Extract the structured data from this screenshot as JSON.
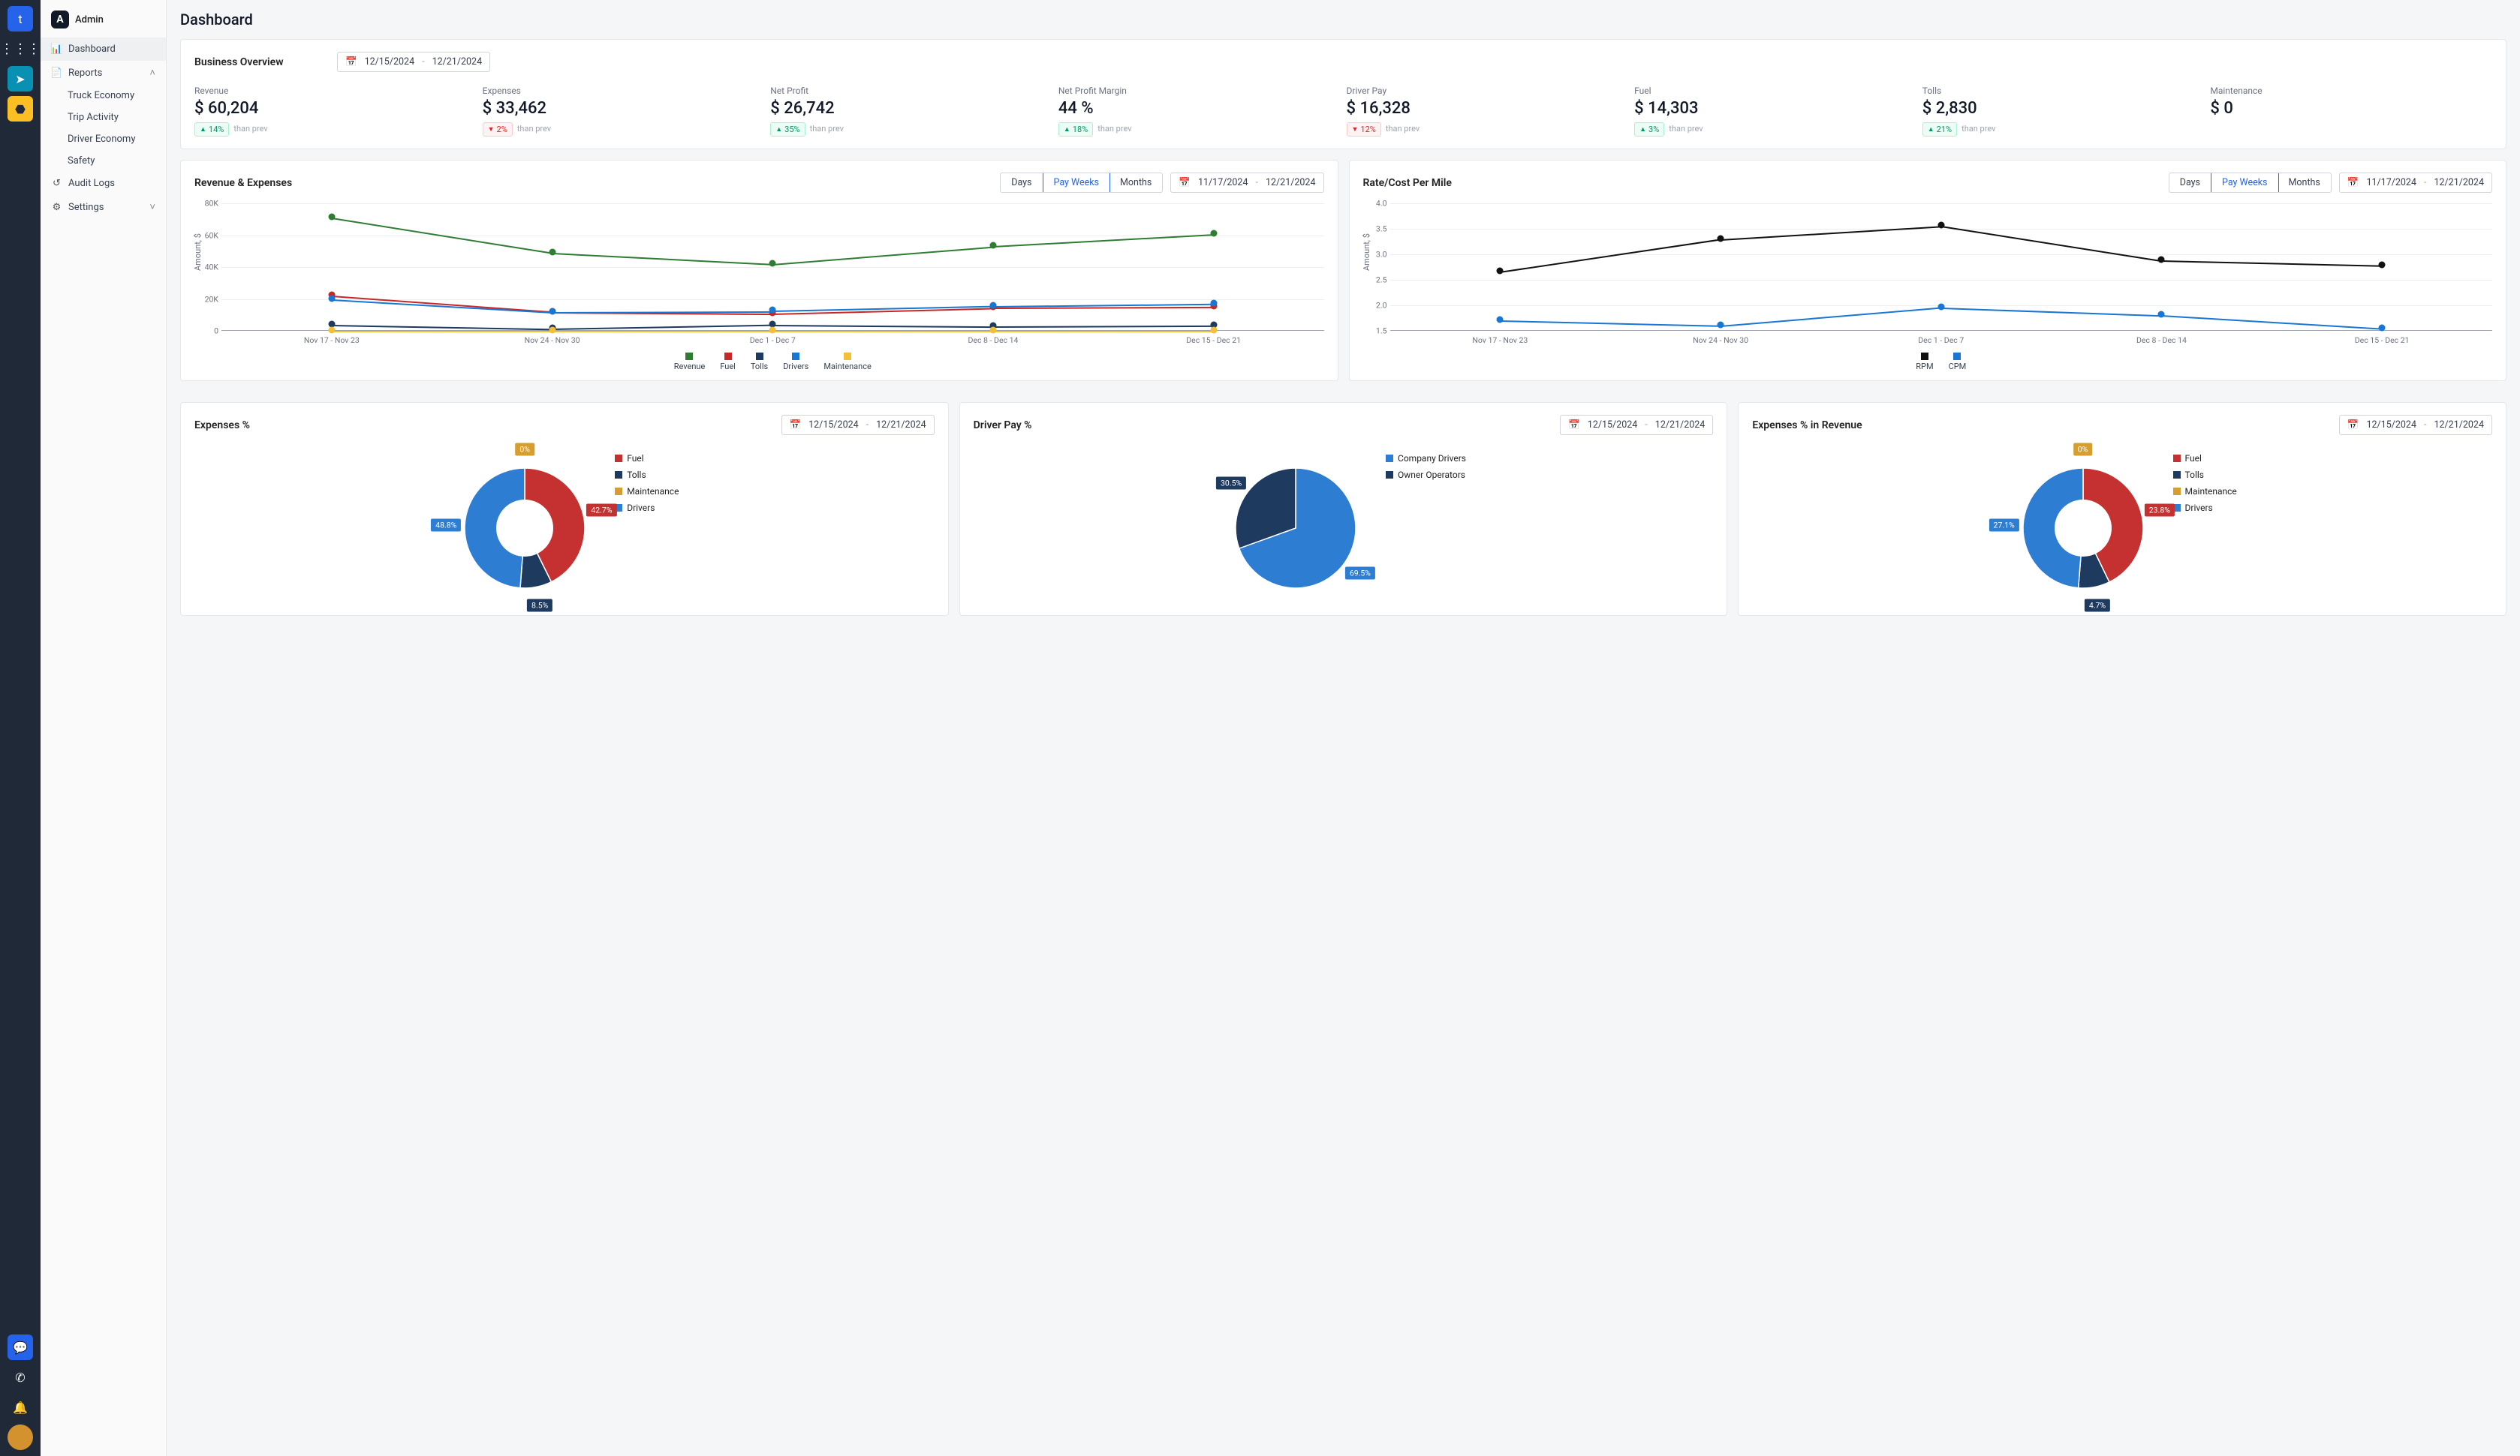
{
  "brand": {
    "user": "Admin",
    "logo_letter": "A"
  },
  "nav": {
    "dashboard": "Dashboard",
    "reports": "Reports",
    "reports_children": [
      "Truck Economy",
      "Trip Activity",
      "Driver Economy",
      "Safety"
    ],
    "audit_logs": "Audit Logs",
    "settings": "Settings"
  },
  "page_title": "Dashboard",
  "overview": {
    "title": "Business Overview",
    "date_from": "12/15/2024",
    "date_to": "12/21/2024",
    "prev_text": "than prev",
    "metrics": [
      {
        "label": "Revenue",
        "value": "$ 60,204",
        "delta": "14%",
        "dir": "up"
      },
      {
        "label": "Expenses",
        "value": "$ 33,462",
        "delta": "2%",
        "dir": "down"
      },
      {
        "label": "Net Profit",
        "value": "$ 26,742",
        "delta": "35%",
        "dir": "up"
      },
      {
        "label": "Net Profit Margin",
        "value": "44 %",
        "delta": "18%",
        "dir": "up"
      },
      {
        "label": "Driver Pay",
        "value": "$ 16,328",
        "delta": "12%",
        "dir": "down"
      },
      {
        "label": "Fuel",
        "value": "$ 14,303",
        "delta": "3%",
        "dir": "up"
      },
      {
        "label": "Tolls",
        "value": "$ 2,830",
        "delta": "21%",
        "dir": "up"
      },
      {
        "label": "Maintenance",
        "value": "$ 0",
        "delta": "",
        "dir": ""
      }
    ]
  },
  "period_toggle": {
    "days": "Days",
    "pay_weeks": "Pay Weeks",
    "months": "Months",
    "active": "pay_weeks"
  },
  "range_wide": {
    "from": "11/17/2024",
    "to": "12/21/2024"
  },
  "range_week": {
    "from": "12/15/2024",
    "to": "12/21/2024"
  },
  "chart_data": [
    {
      "id": "revenue_expenses",
      "title": "Revenue & Expenses",
      "type": "line",
      "ylabel": "Amount, $",
      "ylim": [
        0,
        80000
      ],
      "y_ticks": [
        "0",
        "20K",
        "40K",
        "60K",
        "80K"
      ],
      "categories": [
        "Nov 17 - Nov 23",
        "Nov 24 - Nov 30",
        "Dec 1 - Dec 7",
        "Dec 8 - Dec 14",
        "Dec 15 - Dec 21"
      ],
      "series": [
        {
          "name": "Revenue",
          "color": "#2e7d32",
          "values": [
            71000,
            49000,
            42000,
            53000,
            60500
          ]
        },
        {
          "name": "Fuel",
          "color": "#c62828",
          "values": [
            22000,
            12000,
            11000,
            14500,
            15000
          ]
        },
        {
          "name": "Tolls",
          "color": "#1e3a5f",
          "values": [
            4000,
            1500,
            4000,
            3000,
            3500
          ]
        },
        {
          "name": "Drivers",
          "color": "#1976d2",
          "values": [
            20000,
            12000,
            12500,
            15500,
            17000
          ]
        },
        {
          "name": "Maintenance",
          "color": "#f2c037",
          "values": [
            0,
            0,
            0,
            0,
            0
          ]
        }
      ]
    },
    {
      "id": "rate_cost_per_mile",
      "title": "Rate/Cost Per Mile",
      "type": "line",
      "ylabel": "Amount, $",
      "ylim": [
        1.5,
        4.0
      ],
      "y_ticks": [
        "1.5",
        "2.0",
        "2.5",
        "3.0",
        "3.5",
        "4.0"
      ],
      "categories": [
        "Nov 17 - Nov 23",
        "Nov 24 - Nov 30",
        "Dec 1 - Dec 7",
        "Dec 8 - Dec 14",
        "Dec 15 - Dec 21"
      ],
      "series": [
        {
          "name": "RPM",
          "color": "#111111",
          "values": [
            2.66,
            3.3,
            3.56,
            2.88,
            2.78
          ]
        },
        {
          "name": "CPM",
          "color": "#1976d2",
          "values": [
            1.7,
            1.6,
            1.96,
            1.81,
            1.55
          ]
        }
      ]
    },
    {
      "id": "expenses_pct",
      "title": "Expenses %",
      "type": "pie",
      "donut": true,
      "series": [
        {
          "name": "Fuel",
          "color": "#c53030",
          "value": 42.7
        },
        {
          "name": "Tolls",
          "color": "#1e3a5f",
          "value": 8.5
        },
        {
          "name": "Maintenance",
          "color": "#d69e2e",
          "value": 0
        },
        {
          "name": "Drivers",
          "color": "#2d7dd2",
          "value": 48.8
        }
      ]
    },
    {
      "id": "driver_pay_pct",
      "title": "Driver Pay %",
      "type": "pie",
      "donut": false,
      "series": [
        {
          "name": "Company Drivers",
          "color": "#2d7dd2",
          "value": 69.5
        },
        {
          "name": "Owner Operators",
          "color": "#1e3a5f",
          "value": 30.5
        }
      ]
    },
    {
      "id": "expenses_pct_in_revenue",
      "title": "Expenses % in Revenue",
      "type": "pie",
      "donut": true,
      "series": [
        {
          "name": "Fuel",
          "color": "#c53030",
          "value": 23.8
        },
        {
          "name": "Tolls",
          "color": "#1e3a5f",
          "value": 4.7
        },
        {
          "name": "Maintenance",
          "color": "#d69e2e",
          "value": 0
        },
        {
          "name": "Drivers",
          "color": "#2d7dd2",
          "value": 27.1
        }
      ]
    }
  ]
}
